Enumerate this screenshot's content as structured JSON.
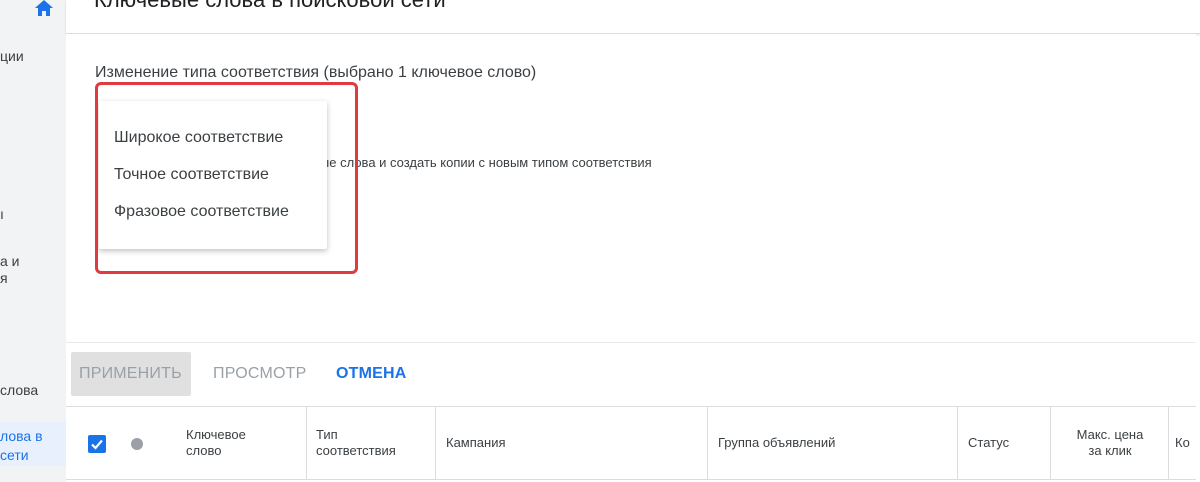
{
  "page": {
    "title": "Ключевые слова в поисковой сети"
  },
  "sidebar": {
    "items": [
      {
        "label": "ции"
      },
      {
        "label": "ı"
      },
      {
        "label": "а и"
      },
      {
        "label": "я"
      },
      {
        "label": "слова"
      },
      {
        "label": "лова в"
      },
      {
        "label": "сети"
      }
    ]
  },
  "change_panel": {
    "title": "Изменение типа соответствия (выбрано 1 ключевое слово)",
    "partial_option": "вые слова и создать копии с новым типом соответствия",
    "dropdown_options": [
      {
        "label": "Широкое соответствие"
      },
      {
        "label": "Точное соответствие"
      },
      {
        "label": "Фразовое соответствие"
      }
    ]
  },
  "actions": {
    "apply_label": "ПРИМЕНИТЬ",
    "preview_label": "ПРОСМОТР",
    "cancel_label": "ОТМЕНА"
  },
  "table": {
    "columns": [
      {
        "label": "Ключевое слово"
      },
      {
        "label": "Тип соответствия"
      },
      {
        "label": "Кампания"
      },
      {
        "label": "Группа объявлений"
      },
      {
        "label": "Статус"
      },
      {
        "label": "Макс. цена за клик"
      },
      {
        "label": "Ко"
      }
    ],
    "select_all_checked": true
  },
  "colors": {
    "accent": "#1a73e8",
    "highlight": "#e0393e"
  }
}
